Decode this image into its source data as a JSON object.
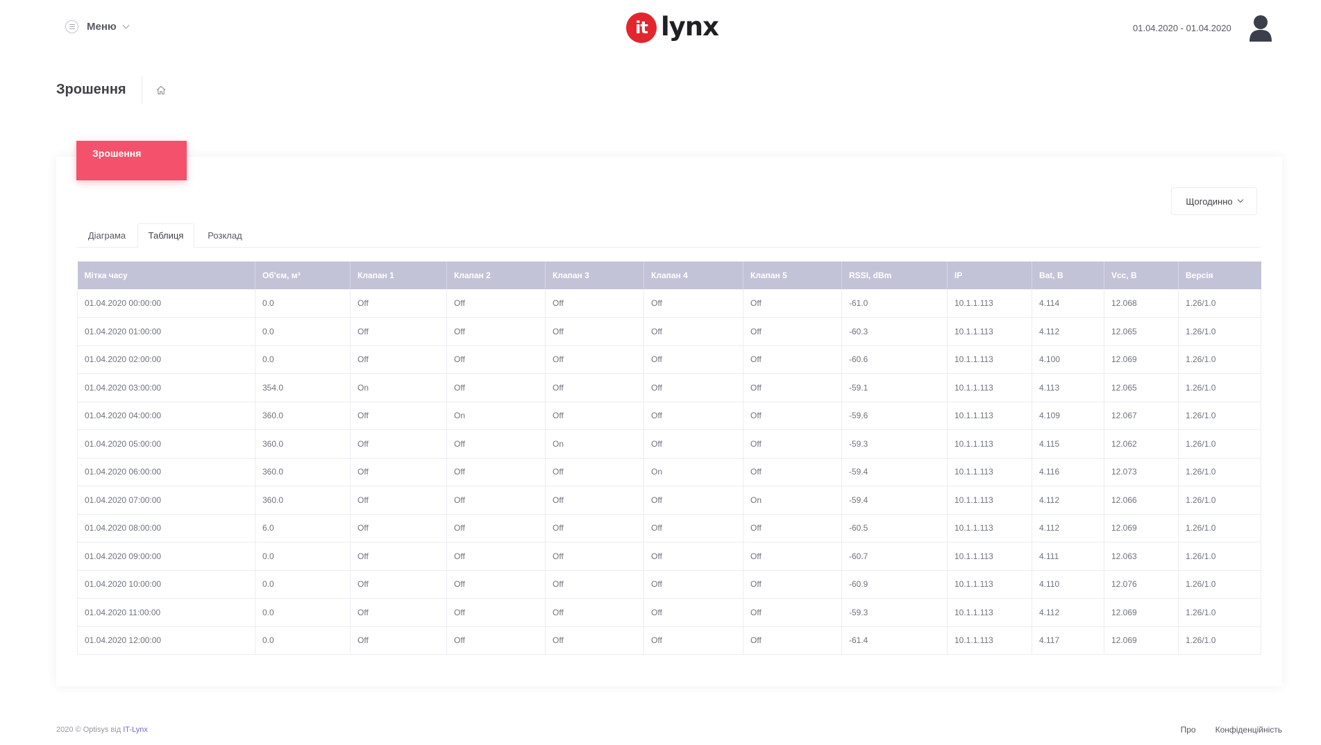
{
  "header": {
    "menu_label": "Меню",
    "logo_mark": "it",
    "logo_text": "lynx",
    "date_range": "01.04.2020 - 01.04.2020"
  },
  "subheader": {
    "title": "Зрошення"
  },
  "portlet": {
    "title": "Зрошення",
    "period_select": "Щогодинно",
    "tabs": [
      {
        "label": "Діаграма"
      },
      {
        "label": "Таблиця"
      },
      {
        "label": "Розклад"
      }
    ],
    "active_tab": "Таблиця"
  },
  "table": {
    "columns": [
      "Мітка часу",
      "Об'єм, м³",
      "Клапан 1",
      "Клапан 2",
      "Клапан 3",
      "Клапан 4",
      "Клапан 5",
      "RSSI, dBm",
      "IP",
      "Bat, В",
      "Vcc, В",
      "Версія"
    ],
    "rows": [
      [
        "01.04.2020 00:00:00",
        "0.0",
        "Off",
        "Off",
        "Off",
        "Off",
        "Off",
        "-61.0",
        "10.1.1.113",
        "4.114",
        "12.068",
        "1.26/1.0"
      ],
      [
        "01.04.2020 01:00:00",
        "0.0",
        "Off",
        "Off",
        "Off",
        "Off",
        "Off",
        "-60.3",
        "10.1.1.113",
        "4.112",
        "12.065",
        "1.26/1.0"
      ],
      [
        "01.04.2020 02:00:00",
        "0.0",
        "Off",
        "Off",
        "Off",
        "Off",
        "Off",
        "-60.6",
        "10.1.1.113",
        "4.100",
        "12.069",
        "1.26/1.0"
      ],
      [
        "01.04.2020 03:00:00",
        "354.0",
        "On",
        "Off",
        "Off",
        "Off",
        "Off",
        "-59.1",
        "10.1.1.113",
        "4.113",
        "12.065",
        "1.26/1.0"
      ],
      [
        "01.04.2020 04:00:00",
        "360.0",
        "Off",
        "On",
        "Off",
        "Off",
        "Off",
        "-59.6",
        "10.1.1.113",
        "4.109",
        "12.067",
        "1.26/1.0"
      ],
      [
        "01.04.2020 05:00:00",
        "360.0",
        "Off",
        "Off",
        "On",
        "Off",
        "Off",
        "-59.3",
        "10.1.1.113",
        "4.115",
        "12.062",
        "1.26/1.0"
      ],
      [
        "01.04.2020 06:00:00",
        "360.0",
        "Off",
        "Off",
        "Off",
        "On",
        "Off",
        "-59.4",
        "10.1.1.113",
        "4.116",
        "12.073",
        "1.26/1.0"
      ],
      [
        "01.04.2020 07:00:00",
        "360.0",
        "Off",
        "Off",
        "Off",
        "Off",
        "On",
        "-59.4",
        "10.1.1.113",
        "4.112",
        "12.066",
        "1.26/1.0"
      ],
      [
        "01.04.2020 08:00:00",
        "6.0",
        "Off",
        "Off",
        "Off",
        "Off",
        "Off",
        "-60.5",
        "10.1.1.113",
        "4.112",
        "12.069",
        "1.26/1.0"
      ],
      [
        "01.04.2020 09:00:00",
        "0.0",
        "Off",
        "Off",
        "Off",
        "Off",
        "Off",
        "-60.7",
        "10.1.1.113",
        "4.111",
        "12.063",
        "1.26/1.0"
      ],
      [
        "01.04.2020 10:00:00",
        "0.0",
        "Off",
        "Off",
        "Off",
        "Off",
        "Off",
        "-60.9",
        "10.1.1.113",
        "4.110",
        "12.076",
        "1.26/1.0"
      ],
      [
        "01.04.2020 11:00:00",
        "0.0",
        "Off",
        "Off",
        "Off",
        "Off",
        "Off",
        "-59.3",
        "10.1.1.113",
        "4.112",
        "12.069",
        "1.26/1.0"
      ],
      [
        "01.04.2020 12:00:00",
        "0.0",
        "Off",
        "Off",
        "Off",
        "Off",
        "Off",
        "-61.4",
        "10.1.1.113",
        "4.117",
        "12.069",
        "1.26/1.0"
      ]
    ]
  },
  "footer": {
    "copyright": "2020 © Optisys від ",
    "company_link": "IT-Lynx",
    "links": [
      {
        "label": "Про"
      },
      {
        "label": "Конфіденційність"
      }
    ]
  },
  "colors": {
    "accent": "#f4516c",
    "table_header": "#c3c3d8",
    "logo_red": "#e3262e",
    "link": "#716aca"
  },
  "icons": [
    "menu-icon",
    "chevron-down-icon",
    "user-avatar-icon",
    "home-icon"
  ]
}
